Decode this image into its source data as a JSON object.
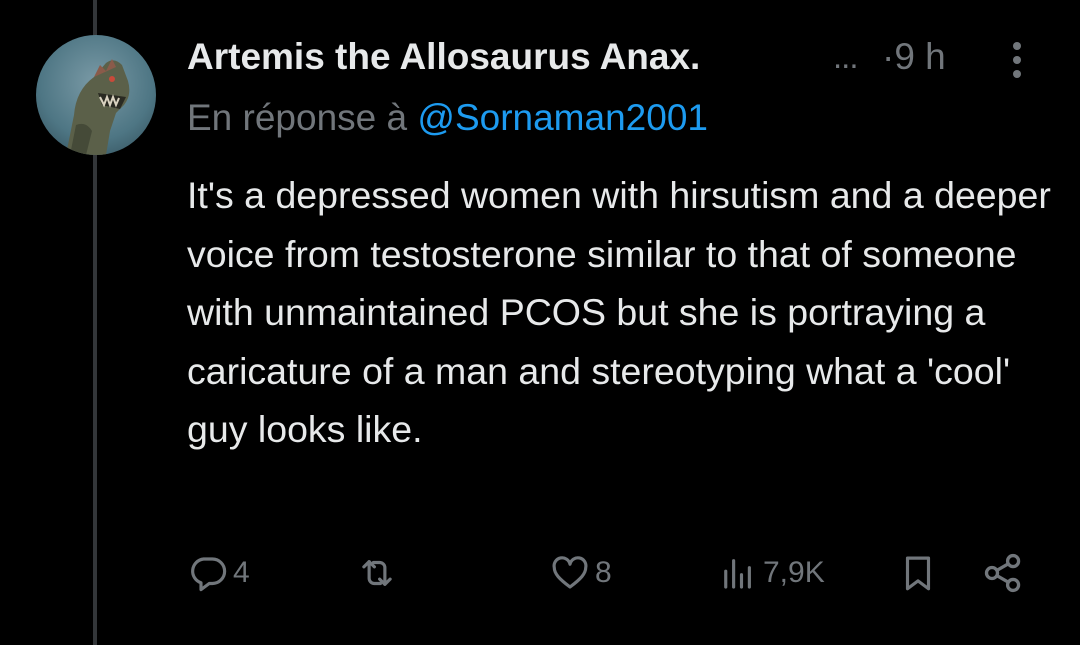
{
  "post": {
    "author_name": "Artemis the Allosaurus Anax.",
    "author_truncation": "...",
    "time_separator": "·",
    "time": "9 h",
    "reply_prefix": "En réponse à",
    "reply_mention": "@Sornaman2001",
    "text": "It's a depressed women with hirsutism and a deeper voice from testosterone similar to that of someone with unmaintained PCOS but she is portraying a caricature of a man and stereotyping what a 'cool' guy looks like."
  },
  "actions": {
    "reply_count": "4",
    "repost_count": "",
    "like_count": "8",
    "views_count": "7,9K"
  },
  "icons": {
    "reply": "reply-icon",
    "repost": "repost-icon",
    "like": "heart-icon",
    "views": "views-icon",
    "bookmark": "bookmark-icon",
    "share": "share-icon",
    "more": "more-icon"
  },
  "colors": {
    "background": "#000000",
    "text": "#e7e9ea",
    "secondary": "#71767b",
    "mention": "#1d9bf0",
    "thread_line": "#333639"
  }
}
